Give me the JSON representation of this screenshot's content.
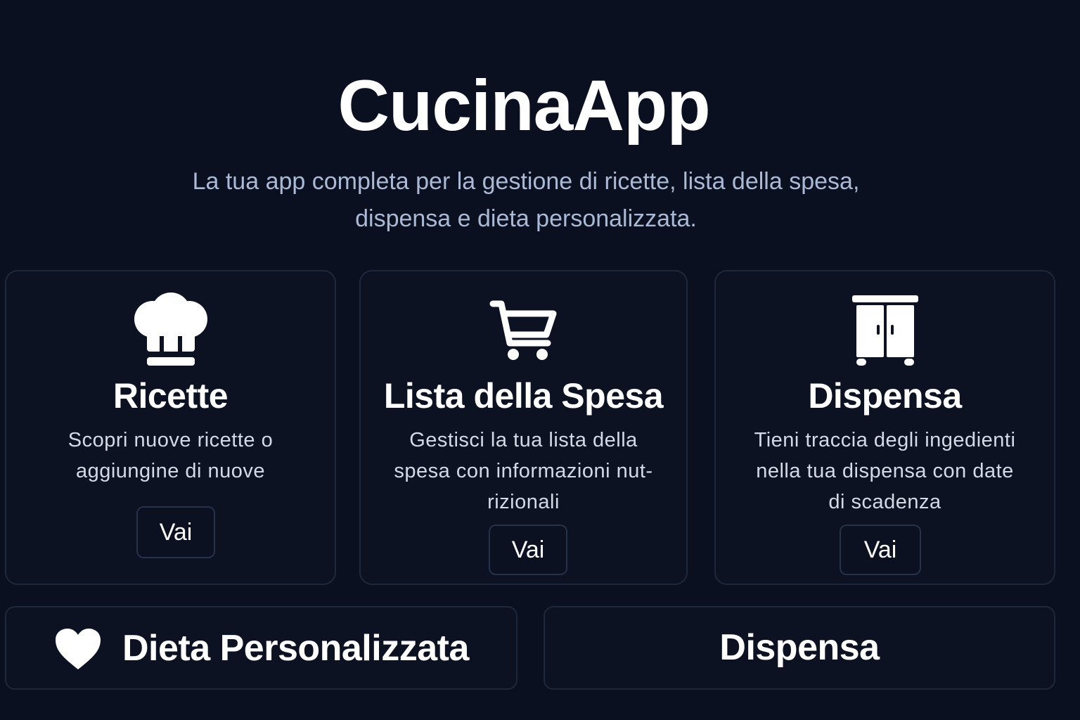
{
  "app": {
    "title": "CucinaApp",
    "subtitle_line1": "La tua app completa per la gestione di ricette, lista della spesa,",
    "subtitle_line2": "dispensa e dieta personalizzata."
  },
  "cards": [
    {
      "icon": "chef-hat-icon",
      "title": "Ricette",
      "desc_lines": [
        "Scopri nuove ricette o",
        "aggiungine di nuove"
      ],
      "button_label": "Vai"
    },
    {
      "icon": "shopping-cart-icon",
      "title": "Lista della Spesa",
      "desc_lines": [
        "Gestisci la tua lista della",
        "spesa con informazioni nut-",
        "rizionali"
      ],
      "button_label": "Vai"
    },
    {
      "icon": "pantry-cabinet-icon",
      "title": "Dispensa",
      "desc_lines": [
        "Tieni traccia degli ingedienti",
        "nella tua dispensa con date",
        "di scadenza"
      ],
      "button_label": "Vai"
    }
  ],
  "bottom_buttons": [
    {
      "icon": "heart-icon",
      "label": "Dieta Personalizzata"
    },
    {
      "label": "Dispensa"
    }
  ],
  "colors": {
    "background": "#0b1020",
    "card_background": "#0c1222",
    "card_border": "#1e283c",
    "subtitle": "#a9b9d6",
    "text": "#ffffff"
  }
}
